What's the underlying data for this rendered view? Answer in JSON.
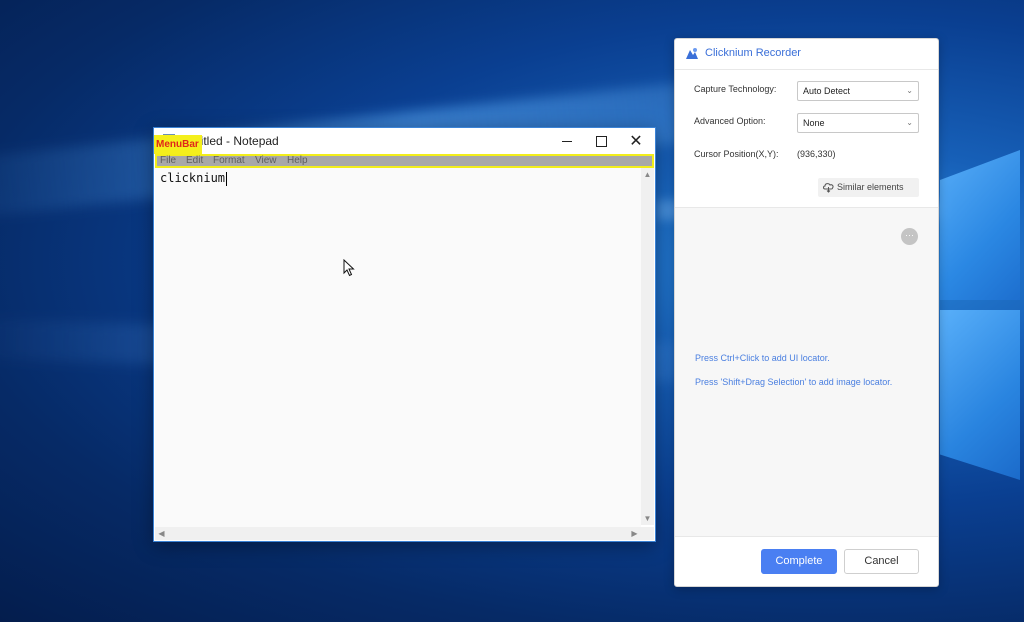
{
  "notepad": {
    "title": "Untitled - Notepad",
    "overlay_label": "MenuBar",
    "menu": [
      "File",
      "Edit",
      "Format",
      "View",
      "Help"
    ],
    "content": "clicknium"
  },
  "recorder": {
    "title": "Clicknium Recorder",
    "capture_label": "Capture Technology:",
    "capture_value": "Auto Detect",
    "advanced_label": "Advanced Option:",
    "advanced_value": "None",
    "cursor_label": "Cursor Position(X,Y):",
    "cursor_value": "(936,330)",
    "similar_label": "Similar elements",
    "more_label": "···",
    "hint_ui": "Press Ctrl+Click to add UI locator.",
    "hint_image": "Press 'Shift+Drag Selection' to add image locator.",
    "complete_label": "Complete",
    "cancel_label": "Cancel"
  },
  "colors": {
    "accent": "#4a7ff2",
    "highlight_border": "#f2ee1a",
    "overlay_text": "#e0261b",
    "hint_text": "#4a7fe0"
  }
}
